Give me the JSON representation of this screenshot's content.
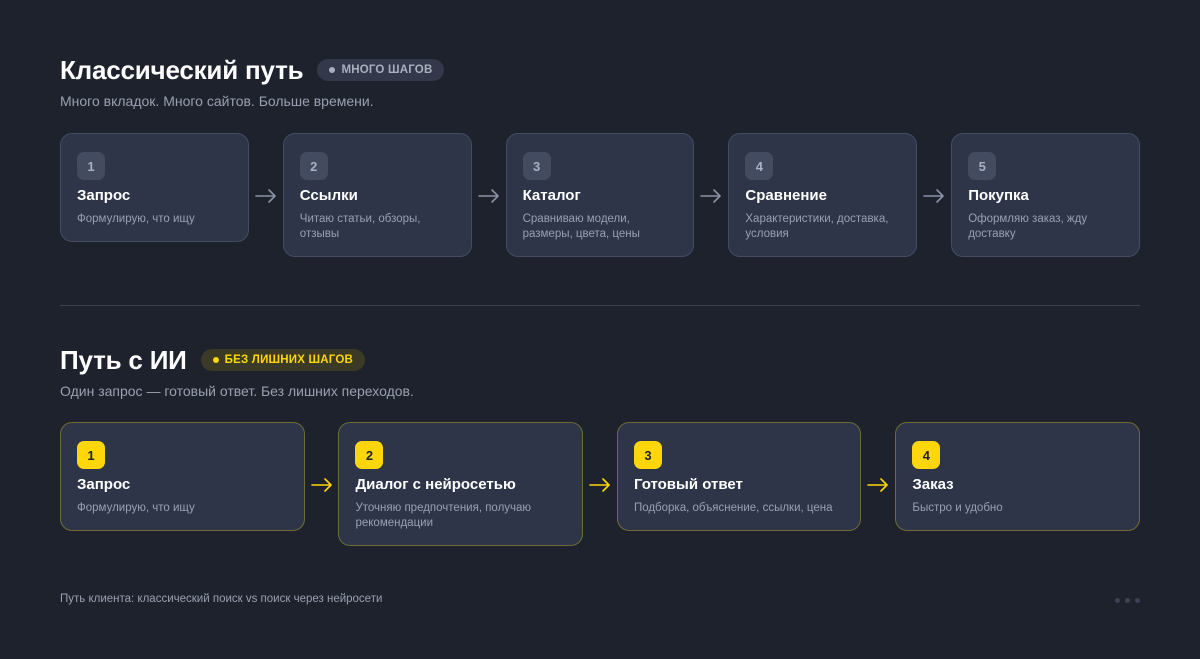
{
  "classic": {
    "title": "Классический путь",
    "badge": "МНОГО ШАГОВ",
    "subtitle": "Много вкладок. Много сайтов. Больше времени.",
    "steps": [
      {
        "num": "1",
        "title": "Запрос",
        "desc": "Формулирую, что ищу"
      },
      {
        "num": "2",
        "title": "Ссылки",
        "desc": "Читаю статьи, обзоры, отзывы"
      },
      {
        "num": "3",
        "title": "Каталог",
        "desc": "Сравниваю модели, размеры, цвета, цены"
      },
      {
        "num": "4",
        "title": "Сравнение",
        "desc": "Характеристики, доставка, условия"
      },
      {
        "num": "5",
        "title": "Покупка",
        "desc": "Оформляю заказ, жду доставку"
      }
    ]
  },
  "ai": {
    "title": "Путь с ИИ",
    "badge": "БЕЗ ЛИШНИХ ШАГОВ",
    "subtitle": "Один запрос — готовый ответ. Без лишних переходов.",
    "steps": [
      {
        "num": "1",
        "title": "Запрос",
        "desc": "Формулирую, что ищу"
      },
      {
        "num": "2",
        "title": "Диалог с нейросетью",
        "desc": "Уточняю предпочтения, получаю рекомендации"
      },
      {
        "num": "3",
        "title": "Готовый ответ",
        "desc": "Подборка, объяснение, ссылки, цена"
      },
      {
        "num": "4",
        "title": "Заказ",
        "desc": "Быстро и удобно"
      }
    ]
  },
  "footer": {
    "caption": "Путь клиента: классический поиск vs поиск через нейросети"
  },
  "colors": {
    "background": "#1e222d",
    "card": "#2e3549",
    "accent": "#ffd60a",
    "muted": "#98a0b2"
  },
  "icons": {
    "arrow": "arrow-right-icon",
    "dot": "dot-icon"
  }
}
